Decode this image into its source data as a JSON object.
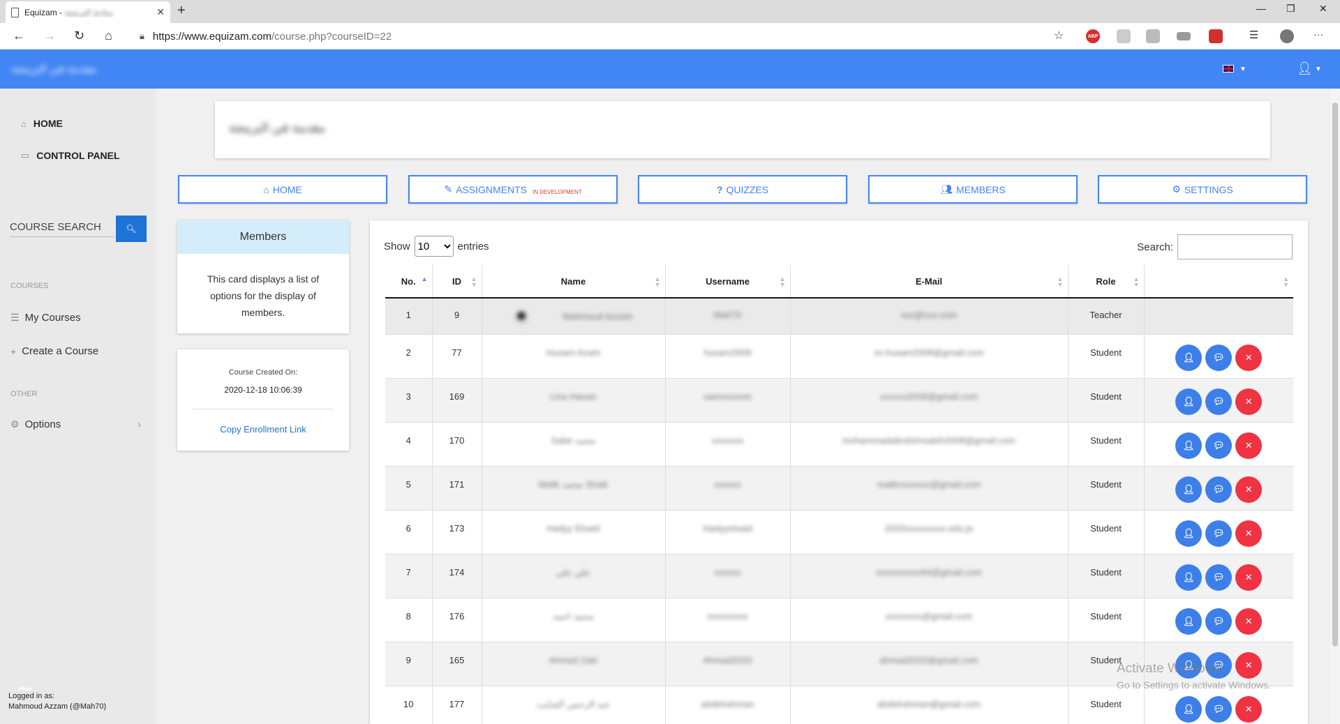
{
  "browser": {
    "tab_title": "Equizam - ",
    "tab_title_blurred": "مبادئ البرمجة",
    "url_host": "https://www.equizam.com",
    "url_path": "/course.php?courseID=22"
  },
  "header": {
    "brand": "مقدمة في البرمجة"
  },
  "sidebar": {
    "links": [
      {
        "label": "HOME",
        "icon": "home-icon"
      },
      {
        "label": "CONTROL PANEL",
        "icon": "panel-icon"
      }
    ],
    "course_search_label": "COURSE SEARCH",
    "courses_heading": "COURSES",
    "courses_items": [
      {
        "label": "My Courses",
        "icon": "list-icon"
      },
      {
        "label": "Create a Course",
        "icon": "plus-icon"
      }
    ],
    "other_heading": "OTHER",
    "options_label": "Options",
    "logged_in_label": "Logged in as:",
    "logged_in_user": "Mahmoud Azzam (@Mah70)"
  },
  "course_title": "مقدمة في البرمجة",
  "nav_buttons": [
    {
      "label": "HOME",
      "icon": "home-icon"
    },
    {
      "label": "ASSIGNMENTS",
      "icon": "pencil-icon",
      "badge": "IN DEVELOPMENT"
    },
    {
      "label": "QUIZZES",
      "icon": "question-icon"
    },
    {
      "label": "MEMBERS",
      "icon": "users-icon"
    },
    {
      "label": "SETTINGS",
      "icon": "gear-icon"
    }
  ],
  "members_card": {
    "title": "Members",
    "body": "This card displays a list of options for the display of members."
  },
  "info_card": {
    "created_label": "Course Created On:",
    "created_value": "2020-12-18 10:06:39",
    "link_label": "Copy Enrollment Link"
  },
  "table": {
    "show_label": "Show",
    "entries_value": "10",
    "entries_label": "entries",
    "search_label": "Search:",
    "columns": [
      "No.",
      "ID",
      "Name",
      "Username",
      "E-Mail",
      "Role",
      ""
    ],
    "rows": [
      {
        "no": "1",
        "id": "9",
        "name": "Mahmoud Azzam",
        "username": "Mah70",
        "email": "xxx@xxx.com",
        "role": "Teacher",
        "avatar": true,
        "actions": false
      },
      {
        "no": "2",
        "id": "77",
        "name": "Husam Azam",
        "username": "husam2008",
        "email": "xx.husam2008@gmail.com",
        "role": "Student",
        "avatar": false,
        "actions": true
      },
      {
        "no": "3",
        "id": "169",
        "name": "Lina Hanan",
        "username": "xamnxxxom",
        "email": "xxxxxx2008@gmail.com",
        "role": "Student",
        "avatar": false,
        "actions": true
      },
      {
        "no": "4",
        "id": "170",
        "name": "Sabe محمد",
        "username": "xxxxxxx",
        "email": "mohammadabrahimsaleh2008@gmail.com",
        "role": "Student",
        "avatar": false,
        "actions": true
      },
      {
        "no": "5",
        "id": "171",
        "name": "Malik محمد Shaik",
        "username": "xxxxxx",
        "email": "malikxxxxxxx@gmail.com",
        "role": "Student",
        "avatar": false,
        "actions": true
      },
      {
        "no": "6",
        "id": "173",
        "name": "Hadyy Elsaid",
        "username": "Hadyyelsaid",
        "email": "2020xxxxxxxxx.edu.jo",
        "role": "Student",
        "avatar": false,
        "actions": true
      },
      {
        "no": "7",
        "id": "174",
        "name": "علي علي",
        "username": "xxxxxx",
        "email": "xxxxxxxxxx94@gmail.com",
        "role": "Student",
        "avatar": false,
        "actions": true
      },
      {
        "no": "8",
        "id": "176",
        "name": "محمد احمد",
        "username": "xxxxxxxxx",
        "email": "xxxxxxxx@gmail.com",
        "role": "Student",
        "avatar": false,
        "actions": true
      },
      {
        "no": "9",
        "id": "165",
        "name": "Ahmad Zaki",
        "username": "Ahmad2020",
        "email": "ahmad2020@gmail.com",
        "role": "Student",
        "avatar": false,
        "actions": true
      },
      {
        "no": "10",
        "id": "177",
        "name": "عبد الرحمن الشايب",
        "username": "abdelrahman",
        "email": "abdelrahman@gmail.com",
        "role": "Student",
        "avatar": false,
        "actions": true
      }
    ]
  },
  "overlay": {
    "activate_title": "Activate Windows",
    "activate_sub": "Go to Settings to activate Windows."
  },
  "colors": {
    "primary": "#4285f4",
    "danger": "#ef3342",
    "accent": "#1e73d6"
  }
}
